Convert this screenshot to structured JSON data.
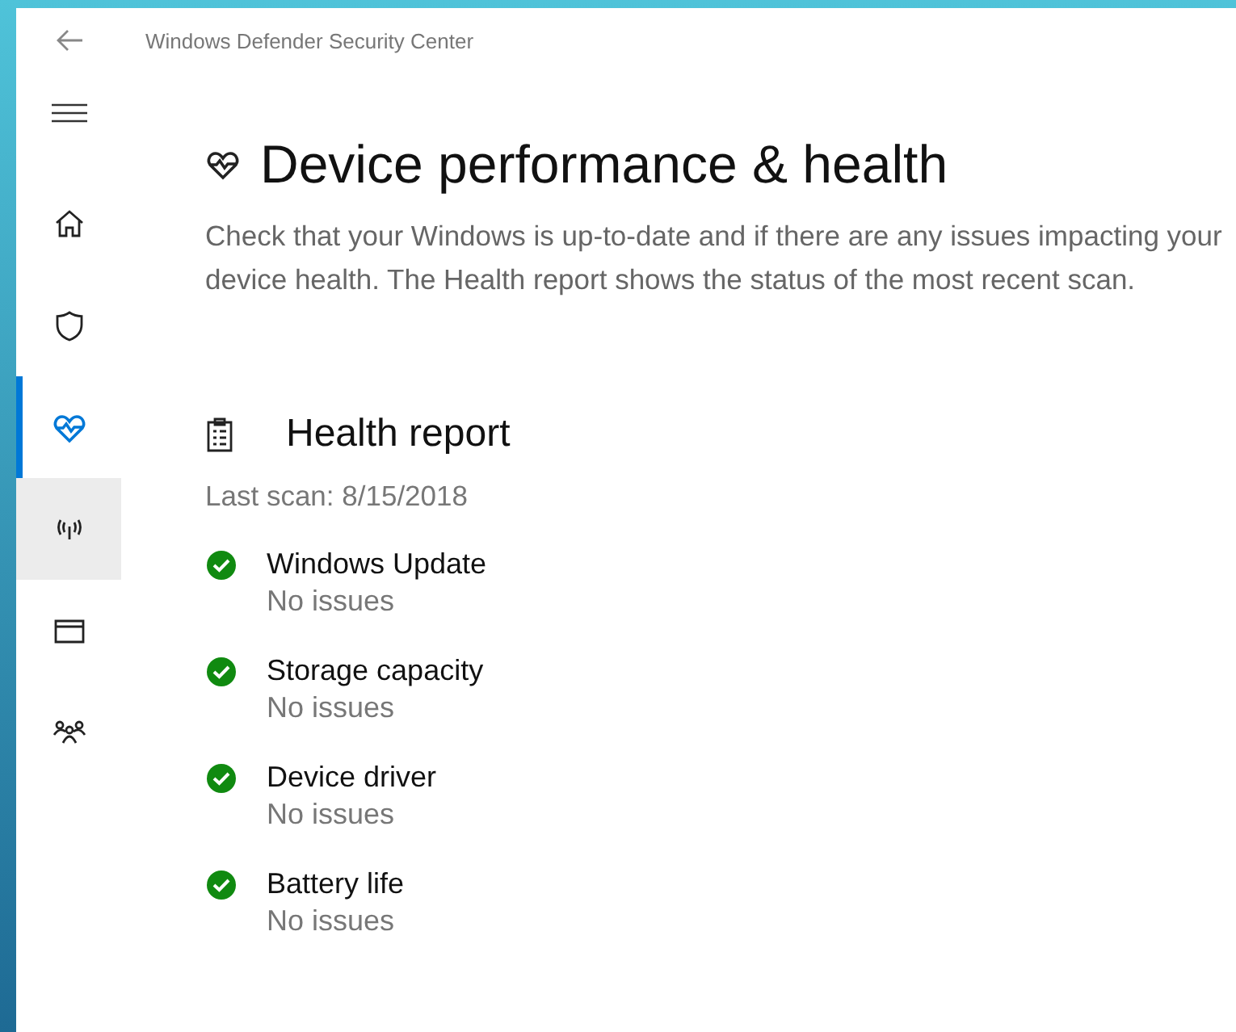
{
  "window": {
    "title": "Windows Defender Security Center"
  },
  "sidebar": {
    "items": [
      {
        "kind": "home",
        "selected": false,
        "hovered": false
      },
      {
        "kind": "shield",
        "selected": false,
        "hovered": false
      },
      {
        "kind": "heart",
        "selected": true,
        "hovered": false
      },
      {
        "kind": "network",
        "selected": false,
        "hovered": true
      },
      {
        "kind": "browser",
        "selected": false,
        "hovered": false
      },
      {
        "kind": "family",
        "selected": false,
        "hovered": false
      }
    ]
  },
  "page": {
    "title": "Device performance & health",
    "description": "Check that your Windows is up-to-date and if there are any issues impacting your device health. The Health report shows the status of the most recent scan."
  },
  "health_report": {
    "title": "Health report",
    "last_scan": "Last scan: 8/15/2018",
    "items": [
      {
        "name": "Windows Update",
        "status": "No issues",
        "ok": true
      },
      {
        "name": "Storage capacity",
        "status": "No issues",
        "ok": true
      },
      {
        "name": "Device driver",
        "status": "No issues",
        "ok": true
      },
      {
        "name": "Battery life",
        "status": "No issues",
        "ok": true
      }
    ]
  }
}
